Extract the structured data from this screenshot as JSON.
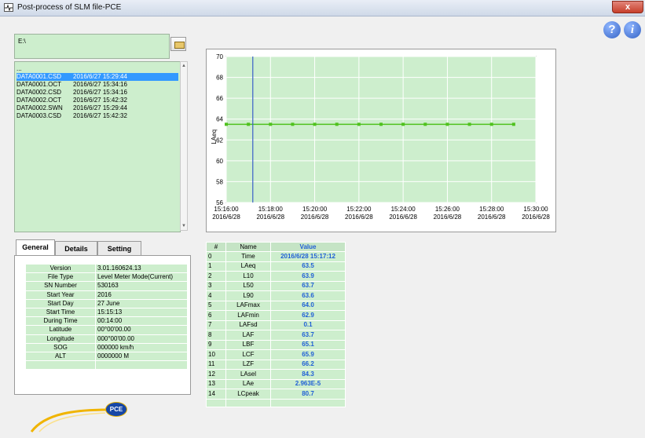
{
  "window": {
    "title": "Post-process of SLM file-PCE",
    "close_label": "x"
  },
  "toolbar": {
    "help_label": "?",
    "info_label": "i"
  },
  "path": {
    "value": "E:\\"
  },
  "file_list": {
    "parent": "...",
    "items": [
      {
        "name": "DATA0001.CSD",
        "date": "2016/6/27 15:29:44",
        "selected": true
      },
      {
        "name": "DATA0001.OCT",
        "date": "2016/6/27 15:34:16",
        "selected": false
      },
      {
        "name": "DATA0002.CSD",
        "date": "2016/6/27 15:34:16",
        "selected": false
      },
      {
        "name": "DATA0002.OCT",
        "date": "2016/6/27 15:42:32",
        "selected": false
      },
      {
        "name": "DATA0002.SWN",
        "date": "2016/6/27 15:29:44",
        "selected": false
      },
      {
        "name": "DATA0003.CSD",
        "date": "2016/6/27 15:42:32",
        "selected": false
      }
    ]
  },
  "tabs": [
    {
      "label": "General",
      "active": true
    },
    {
      "label": "Details",
      "active": false
    },
    {
      "label": "Setting",
      "active": false
    }
  ],
  "properties": [
    {
      "key": "Version",
      "value": "3.01.160624.13"
    },
    {
      "key": "File Type",
      "value": "Level Meter Mode(Current)"
    },
    {
      "key": "SN Number",
      "value": "530163"
    },
    {
      "key": "Start Year",
      "value": "2016"
    },
    {
      "key": "Start Day",
      "value": "27 June"
    },
    {
      "key": "Start Time",
      "value": "15:15:13"
    },
    {
      "key": "During Time",
      "value": "00:14:00"
    },
    {
      "key": "Latitude",
      "value": "00°00'00.00"
    },
    {
      "key": "Longitude",
      "value": "000°00'00.00"
    },
    {
      "key": "SOG",
      "value": "000000 km/h"
    },
    {
      "key": "ALT",
      "value": "0000000 M"
    },
    {
      "key": "",
      "value": ""
    }
  ],
  "chart_data": {
    "type": "line",
    "ylabel": "LAeq",
    "xlabel": "",
    "ylim": [
      56,
      70
    ],
    "yticks": [
      "70",
      "68",
      "66",
      "64",
      "62",
      "60",
      "58",
      "56"
    ],
    "xlim": [
      "15:16:00",
      "15:30:00"
    ],
    "xticks": [
      {
        "time": "15:16:00",
        "date": "2016/6/28"
      },
      {
        "time": "15:18:00",
        "date": "2016/6/28"
      },
      {
        "time": "15:20:00",
        "date": "2016/6/28"
      },
      {
        "time": "15:22:00",
        "date": "2016/6/28"
      },
      {
        "time": "15:24:00",
        "date": "2016/6/28"
      },
      {
        "time": "15:26:00",
        "date": "2016/6/28"
      },
      {
        "time": "15:28:00",
        "date": "2016/6/28"
      },
      {
        "time": "15:30:00",
        "date": "2016/6/28"
      }
    ],
    "series": [
      {
        "x": [
          "15:16:00",
          "15:17:00",
          "15:18:00",
          "15:19:00",
          "15:20:00",
          "15:21:00",
          "15:22:00",
          "15:23:00",
          "15:24:00",
          "15:25:00",
          "15:26:00",
          "15:27:00",
          "15:28:00",
          "15:29:00"
        ],
        "values": [
          63.5,
          63.5,
          63.5,
          63.5,
          63.5,
          63.5,
          63.5,
          63.5,
          63.5,
          63.5,
          63.5,
          63.5,
          63.5,
          63.5
        ]
      }
    ],
    "cursor_x": "15:17:12",
    "grid": true,
    "colors": {
      "background": "#cdeecd",
      "line": "#4fc21e",
      "cursor": "#3a5fc8"
    }
  },
  "data_table": {
    "headers": [
      "#",
      "Name",
      "Value"
    ],
    "rows": [
      [
        "0",
        "Time",
        "2016/6/28 15:17:12"
      ],
      [
        "1",
        "LAeq",
        "63.5"
      ],
      [
        "2",
        "L10",
        "63.9"
      ],
      [
        "3",
        "L50",
        "63.7"
      ],
      [
        "4",
        "L90",
        "63.6"
      ],
      [
        "5",
        "LAFmax",
        "64.0"
      ],
      [
        "6",
        "LAFmin",
        "62.9"
      ],
      [
        "7",
        "LAFsd",
        "0.1"
      ],
      [
        "8",
        "LAF",
        "63.7"
      ],
      [
        "9",
        "LBF",
        "65.1"
      ],
      [
        "10",
        "LCF",
        "65.9"
      ],
      [
        "11",
        "LZF",
        "66.2"
      ],
      [
        "12",
        "LAsel",
        "84.3"
      ],
      [
        "13",
        "LAe",
        "2.963E-5"
      ],
      [
        "14",
        "LCpeak",
        "80.7"
      ]
    ]
  },
  "logo": {
    "text": "PCE"
  }
}
